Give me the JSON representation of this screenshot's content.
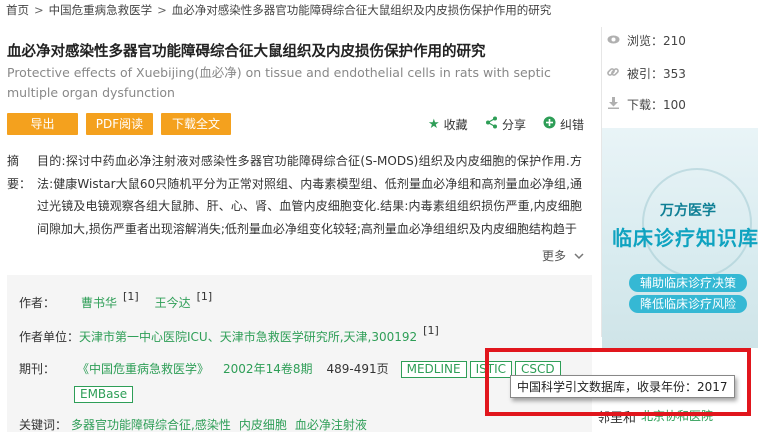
{
  "breadcrumb": {
    "items": [
      "首页",
      "中国危重病急救医学",
      "血必净对感染性多器官功能障碍综合征大鼠组织及内皮损伤保护作用的研究"
    ],
    "separator": ">"
  },
  "article": {
    "title": "血必净对感染性多器官功能障碍综合征大鼠组织及内皮损伤保护作用的研究",
    "title_en": "Protective effects of Xuebijing(血必净) on tissue and endothelial cells in rats with septic multiple organ dysfunction"
  },
  "buttons": {
    "export": "导出",
    "pdf_read": "PDF阅读",
    "download": "下载全文"
  },
  "actions": {
    "favorite": "收藏",
    "share": "分享",
    "correct": "纠错"
  },
  "abstract": {
    "label": "摘要：",
    "text": "目的:探讨中药血必净注射液对感染性多器官功能障碍综合征(S-MODS)组织及内皮细胞的保护作用.方法:健康Wistar大鼠60只随机平分为正常对照组、内毒素模型组、低剂量血必净组和高剂量血必净组,通过光镜及电镜观察各组大鼠肺、肝、心、肾、血管内皮细胞变化.结果:内毒素组组织损伤严重,内皮细胞间隙加大,损伤严重者出现溶解消失;低剂量血必净组变化较轻;高剂量血必净组组织及内皮细胞结构趋于",
    "more": "更多"
  },
  "meta": {
    "author_label": "作者：",
    "authors": [
      {
        "name": "曹书华",
        "sup": "[1]"
      },
      {
        "name": "王今达",
        "sup": "[1]"
      }
    ],
    "unit_label": "作者单位：",
    "unit": "天津市第一中心医院ICU、天津市急救医学研究所,天津,300192",
    "unit_sup": "[1]",
    "journal_label": "期刊：",
    "journal": "《中国危重病急救医学》",
    "issue": "2002年14卷8期",
    "pages": "489-491页",
    "tags": [
      "MEDLINE",
      "ISTIC",
      "CSCD",
      "EMBase"
    ],
    "keywords_label": "关键词：",
    "keywords": [
      "多器官功能障碍综合征,感染性",
      "内皮细胞",
      "血必净注射液"
    ]
  },
  "tooltip": {
    "text": "中国科学引文数据库，收录年份：2017"
  },
  "stats": {
    "views_label": "浏览：",
    "views": "210",
    "cited_label": "被引：",
    "cited": "353",
    "downloads_label": "下载：",
    "downloads": "100"
  },
  "ad": {
    "brand": "万方医学",
    "headline": "临床诊疗知识库",
    "pill1": "辅助临床诊疗决策",
    "pill2": "降低临床诊疗风险"
  },
  "behind": {
    "label": "邻里和",
    "link": "北京协和医院"
  },
  "colors": {
    "accent_orange": "#f4a11e",
    "link_green": "#2e9e57",
    "highlight_red": "#e1161d"
  }
}
